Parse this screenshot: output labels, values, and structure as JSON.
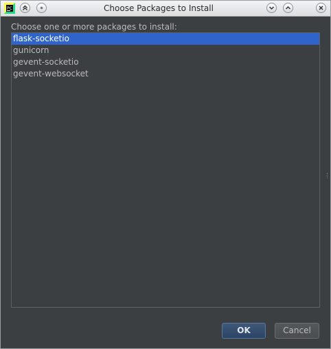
{
  "window": {
    "title": "Choose Packages to Install"
  },
  "dialog": {
    "prompt": "Choose one or more packages to install:",
    "packages": [
      {
        "label": "flask-socketio",
        "selected": true
      },
      {
        "label": "gunicorn",
        "selected": false
      },
      {
        "label": "gevent-socketio",
        "selected": false
      },
      {
        "label": "gevent-websocket",
        "selected": false
      }
    ]
  },
  "buttons": {
    "ok_label": "OK",
    "cancel_label": "Cancel"
  },
  "titlebar_icons": [
    "pycharm-app-icon",
    "shade-up-icon",
    "sticky-dot-icon",
    "minimize-icon",
    "maximize-icon",
    "close-icon"
  ],
  "colors": {
    "selection": "#2f65ca",
    "background": "#3c3f41",
    "text": "#bbbbbb"
  }
}
